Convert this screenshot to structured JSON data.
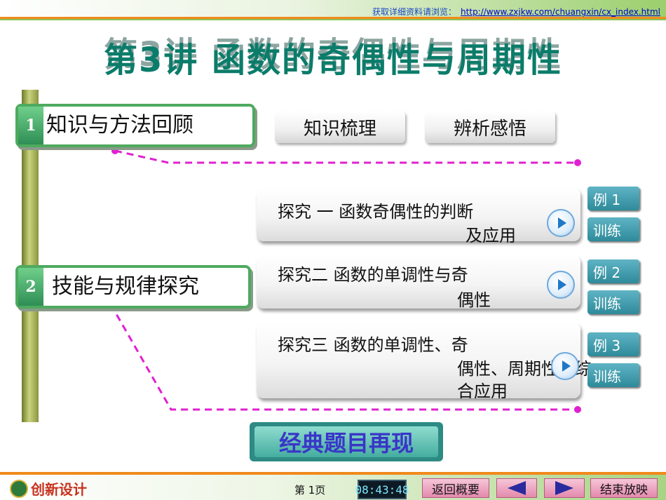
{
  "header": {
    "info_label": "获取详细资料请浏览：",
    "url": "http://www.zxjkw.com/chuangxin/cx_index.html"
  },
  "title": "第3讲   函数的奇偶性与周期性",
  "sections": [
    {
      "num": "1",
      "label": "知识与方法回顾"
    },
    {
      "num": "2",
      "label": "技能与规律探究"
    }
  ],
  "buttons": {
    "knowledge": "知识梳理",
    "insight": "辨析感悟"
  },
  "explores": [
    {
      "line1": "探究  一    函数奇偶性的判断",
      "line2": "及应用",
      "example": "例 1",
      "practice": "训练"
    },
    {
      "line1": "探究二    函数的单调性与奇",
      "line2": "偶性",
      "example": "例 2",
      "practice": "训练"
    },
    {
      "line1": "探究三    函数的单调性、奇",
      "line2": "偶性、周期性的综",
      "line3": "合应用",
      "example": "例 3",
      "practice": "训练"
    }
  ],
  "classic": "经典题目再现",
  "footer": {
    "logo": "创新设计",
    "page": "第 1页",
    "clock": "08:43:48",
    "back_overview": "返回概要",
    "end_show": "结束放映"
  },
  "colors": {
    "accent_green": "#4eaa5e",
    "dashed_magenta": "#e020d0",
    "title_teal": "#0b7c6a",
    "nav_pink": "#e48aad"
  }
}
